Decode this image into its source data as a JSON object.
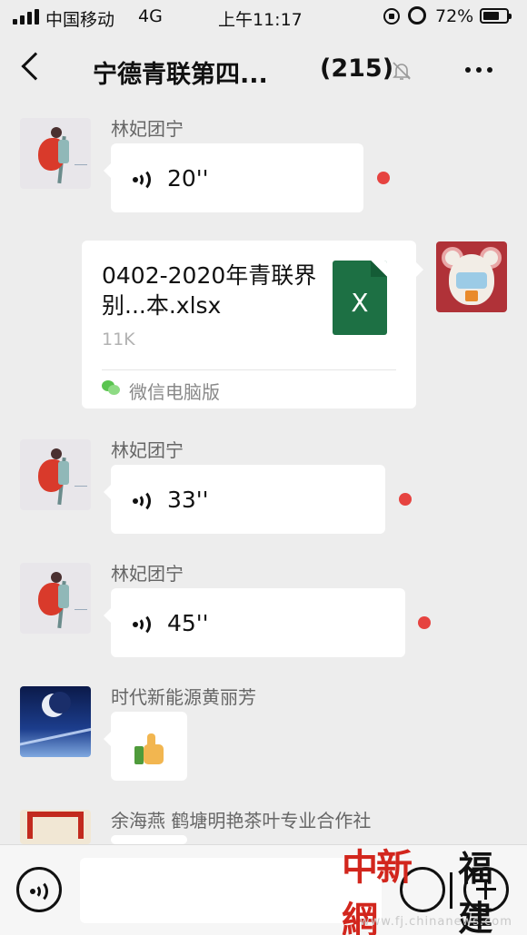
{
  "status_bar": {
    "carrier": "中国移动",
    "network": "4G",
    "time": "上午11:17",
    "battery_percent": "72%",
    "battery_level": 0.72
  },
  "header": {
    "title": "宁德青联第四...",
    "member_count": "(215)"
  },
  "messages": [
    {
      "type": "voice",
      "sender": "林妃团宁",
      "duration": "20''",
      "unread": true
    },
    {
      "type": "file",
      "direction": "outgoing",
      "file_name": "0402-2020年青联界别...本.xlsx",
      "file_size": "11K",
      "file_icon_label": "X",
      "source": "微信电脑版"
    },
    {
      "type": "voice",
      "sender": "林妃团宁",
      "duration": "33''",
      "unread": true
    },
    {
      "type": "voice",
      "sender": "林妃团宁",
      "duration": "45''",
      "unread": true
    },
    {
      "type": "emoji",
      "sender": "时代新能源黄丽芳",
      "emoji": "thumbs-up"
    },
    {
      "type": "partial",
      "sender": "余海燕 鹤塘明艳茶叶专业合作社"
    }
  ],
  "input_bar": {
    "placeholder": ""
  },
  "watermark": {
    "brand": "中新網",
    "region": "福建",
    "url": "www.fj.chinanews.com"
  },
  "colors": {
    "background": "#ededed",
    "unread_dot": "#e64340",
    "excel_green": "#1d7044",
    "watermark_red": "#d2261d"
  }
}
